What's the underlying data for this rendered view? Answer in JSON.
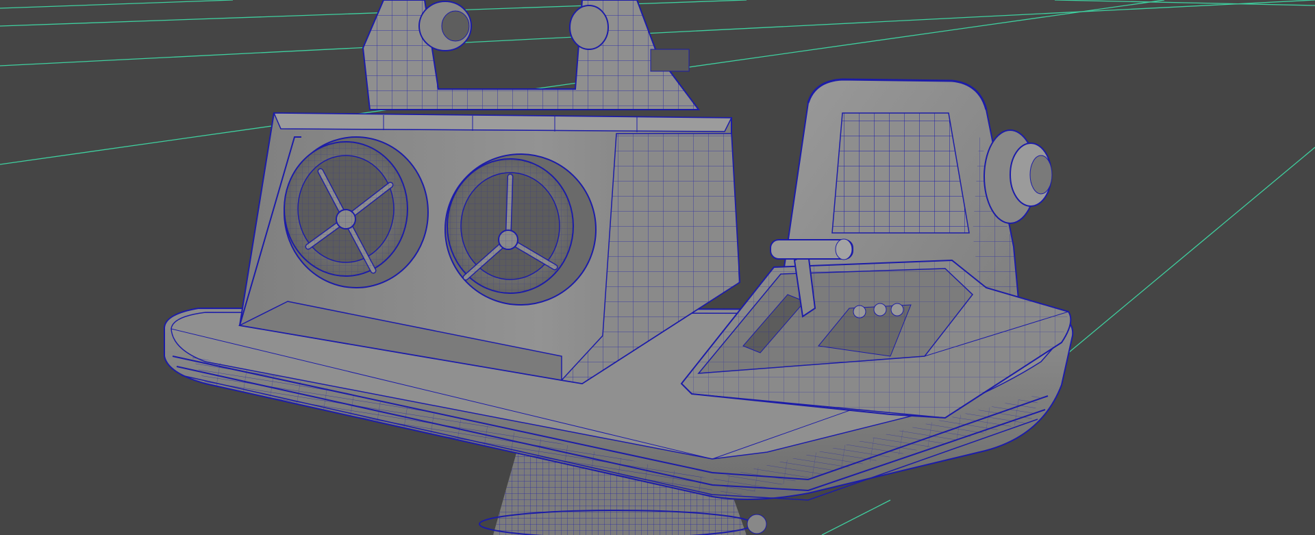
{
  "viewport": {
    "background": "#454545",
    "grid_color": "#3fd1a0",
    "wire_color": "#1c1ca8",
    "mesh_color": "#8d8d8d",
    "mesh_light": "#a4a4a4",
    "mesh_dark": "#6c6c6c",
    "display_mode": "wireframe-on-shaded"
  },
  "scene": {
    "objects": [
      {
        "name": "console-base-plate"
      },
      {
        "name": "pedestal-column"
      },
      {
        "name": "dual-wheel-housing"
      },
      {
        "name": "wheel-left"
      },
      {
        "name": "wheel-right"
      },
      {
        "name": "upper-yoke-bracket"
      },
      {
        "name": "throttle-panel"
      },
      {
        "name": "throttle-lever"
      },
      {
        "name": "control-hood"
      },
      {
        "name": "side-knob"
      }
    ]
  }
}
